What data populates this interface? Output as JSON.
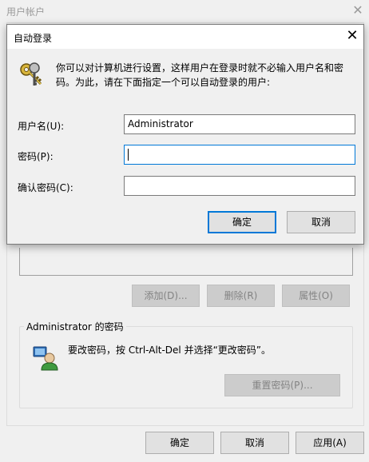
{
  "background_window": {
    "title": "用户帐户",
    "buttons": {
      "add": "添加(D)...",
      "remove": "删除(R)",
      "properties": "属性(O)"
    },
    "password_group": {
      "title": "Administrator 的密码",
      "message": "要改密码，按 Ctrl-Alt-Del 并选择“更改密码”。",
      "reset_button": "重置密码(P)..."
    },
    "footer": {
      "ok": "确定",
      "cancel": "取消",
      "apply": "应用(A)"
    }
  },
  "dialog": {
    "title": "自动登录",
    "description": "你可以对计算机进行设置，这样用户在登录时就不必输入用户名和密码。为此，请在下面指定一个可以自动登录的用户:",
    "fields": {
      "username": {
        "label": "用户名(U):",
        "value": "Administrator"
      },
      "password": {
        "label": "密码(P):",
        "value": ""
      },
      "confirm": {
        "label": "确认密码(C):",
        "value": ""
      }
    },
    "ok": "确定",
    "cancel": "取消"
  },
  "icons": {
    "keys": "keys-icon",
    "user": "user-icon",
    "close": "close-icon"
  },
  "colors": {
    "focus": "#0078d7",
    "disabled_text": "#838383"
  }
}
